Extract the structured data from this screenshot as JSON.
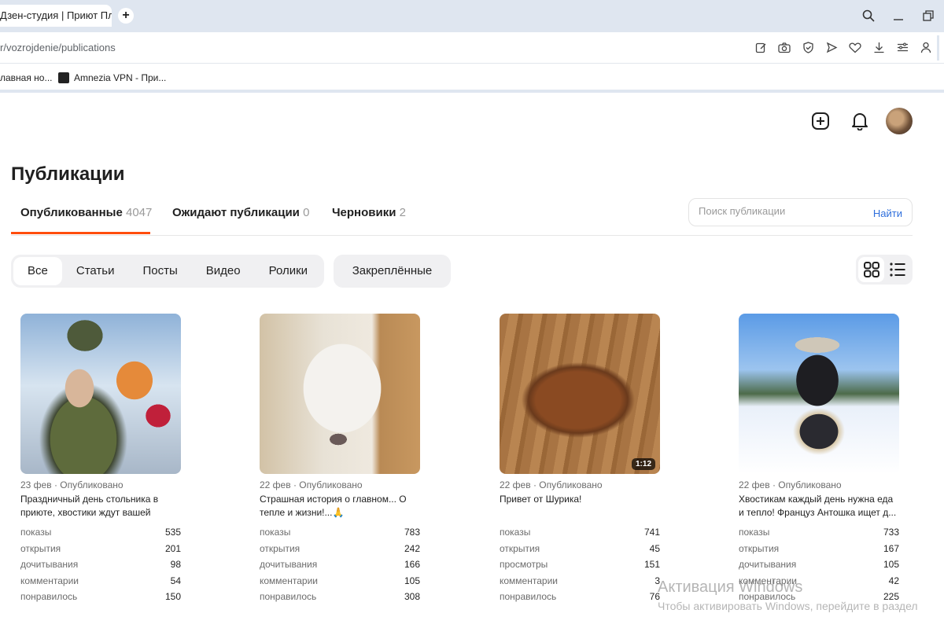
{
  "browser": {
    "tab_title": "Дзен-студия | Приют Пла",
    "url": "r/vozrojdenie/publications",
    "bookmarks": [
      {
        "label": "лавная но..."
      },
      {
        "label": "Amnezia VPN - При..."
      }
    ]
  },
  "page": {
    "title": "Публикации",
    "tabs": [
      {
        "label": "Опубликованные",
        "count": "4047"
      },
      {
        "label": "Ожидают публикации",
        "count": "0"
      },
      {
        "label": "Черновики",
        "count": "2"
      }
    ],
    "search": {
      "placeholder": "Поиск публикации",
      "button": "Найти"
    },
    "filters": [
      "Все",
      "Статьи",
      "Посты",
      "Видео",
      "Ролики"
    ],
    "pinned": "Закреплённые",
    "accent_color": "#ff4d0d",
    "link_color": "#2f6fdc"
  },
  "cards": [
    {
      "meta": "23 фев · Опубликовано",
      "title": "Праздничный день стольника в приюте, хвостики ждут вашей помощ...",
      "stats": [
        {
          "k": "показы",
          "v": "535"
        },
        {
          "k": "открытия",
          "v": "201"
        },
        {
          "k": "дочитывания",
          "v": "98"
        },
        {
          "k": "комментарии",
          "v": "54"
        },
        {
          "k": "понравилось",
          "v": "150"
        }
      ]
    },
    {
      "meta": "22 фев · Опубликовано",
      "title": "Страшная история о главном... О тепле и жизни!...🙏",
      "stats": [
        {
          "k": "показы",
          "v": "783"
        },
        {
          "k": "открытия",
          "v": "242"
        },
        {
          "k": "дочитывания",
          "v": "166"
        },
        {
          "k": "комментарии",
          "v": "105"
        },
        {
          "k": "понравилось",
          "v": "308"
        }
      ]
    },
    {
      "meta": "22 фев · Опубликовано",
      "title": "Привет от Шурика!",
      "duration": "1:12",
      "stats": [
        {
          "k": "показы",
          "v": "741"
        },
        {
          "k": "открытия",
          "v": "45"
        },
        {
          "k": "просмотры",
          "v": "151"
        },
        {
          "k": "комментарии",
          "v": "3"
        },
        {
          "k": "понравилось",
          "v": "76"
        }
      ]
    },
    {
      "meta": "22 фев · Опубликовано",
      "title": "Хвостикам каждый день нужна еда и тепло! Француз Антошка ищет д...",
      "stats": [
        {
          "k": "показы",
          "v": "733"
        },
        {
          "k": "открытия",
          "v": "167"
        },
        {
          "k": "дочитывания",
          "v": "105"
        },
        {
          "k": "комментарии",
          "v": "42"
        },
        {
          "k": "понравилось",
          "v": "225"
        }
      ]
    }
  ],
  "watermark": {
    "line1": "Активация Windows",
    "line2": "Чтобы активировать Windows, перейдите в раздел"
  }
}
